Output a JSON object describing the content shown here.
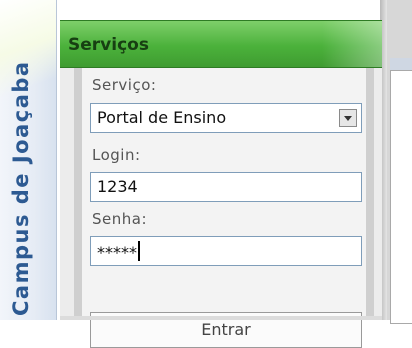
{
  "sidebar": {
    "campus_title": "Campus de Joaçaba"
  },
  "panel": {
    "title": "Serviços"
  },
  "form": {
    "service_label": "Serviço:",
    "service_selected": "Portal de Ensino",
    "login_label": "Login:",
    "login_value": "1234",
    "password_label": "Senha:",
    "password_value": "*****",
    "submit_label": "Entrar"
  },
  "colors": {
    "header_green": "#4bb13b",
    "campus_blue": "#2d5a92"
  },
  "icons": {
    "select_arrow": "chevron-down-icon"
  }
}
